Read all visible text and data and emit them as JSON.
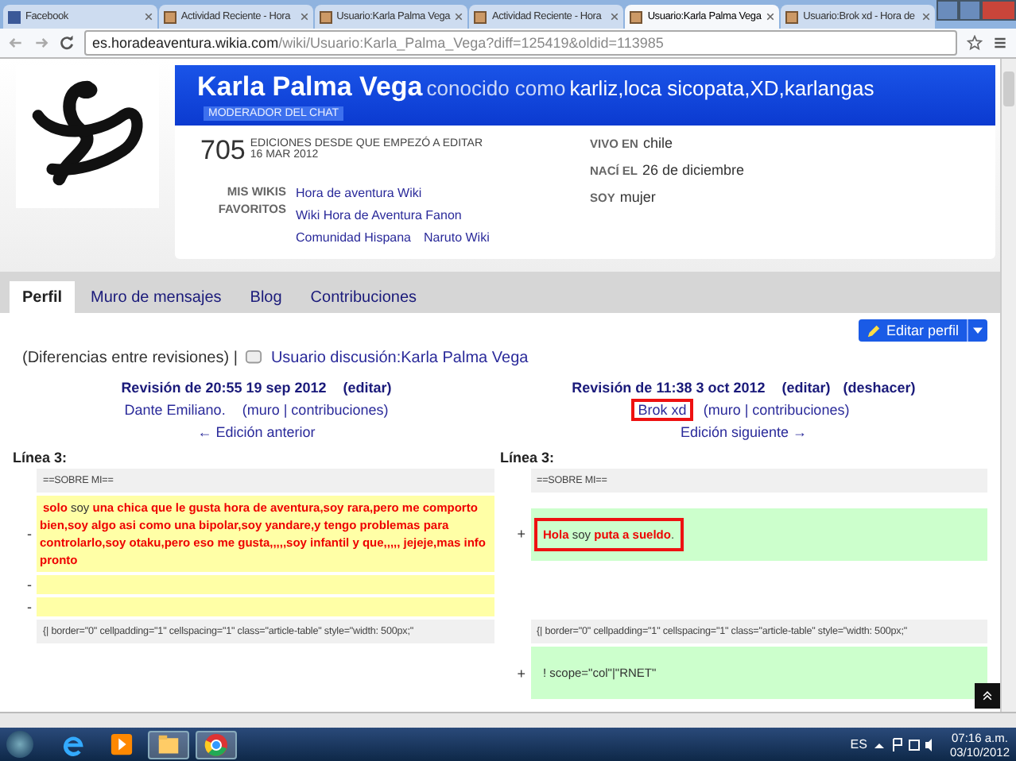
{
  "browser_tabs": [
    {
      "title": "Facebook",
      "kind": "facebook",
      "selected": false
    },
    {
      "title": "Actividad Reciente - Hora",
      "kind": "wiki",
      "selected": false
    },
    {
      "title": "Usuario:Karla Palma Vega",
      "kind": "wiki",
      "selected": false
    },
    {
      "title": "Actividad Reciente - Hora",
      "kind": "wiki",
      "selected": false
    },
    {
      "title": "Usuario:Karla Palma Vega",
      "kind": "wiki",
      "selected": true
    },
    {
      "title": "Usuario:Brok xd - Hora de",
      "kind": "wiki",
      "selected": false
    }
  ],
  "address": {
    "host": "es.horadeaventura.wikia.com",
    "path": "/wiki/Usuario:Karla_Palma_Vega?diff=125419&oldid=113985"
  },
  "profile": {
    "name": "Karla Palma Vega",
    "aka_label": "conocido como",
    "aka": "karliz,loca sicopata,XD,karlangas",
    "badge": "MODERADOR DEL CHAT",
    "edits": "705",
    "edits_label": "EDICIONES DESDE QUE EMPEZÓ A EDITAR",
    "since": "16 MAR 2012",
    "wikis_label": "MIS WIKIS FAVORITOS",
    "wikis": [
      "Hora de aventura Wiki",
      "Wiki Hora de Aventura Fanon",
      "Comunidad Hispana",
      "Naruto Wiki"
    ],
    "facts": [
      {
        "label": "VIVO EN",
        "value": "chile"
      },
      {
        "label": "NACÍ EL",
        "value": "26 de diciembre"
      },
      {
        "label": "SOY",
        "value": "mujer"
      }
    ]
  },
  "page_tabs": [
    {
      "label": "Perfil",
      "selected": true
    },
    {
      "label": "Muro de mensajes",
      "selected": false
    },
    {
      "label": "Blog",
      "selected": false
    },
    {
      "label": "Contribuciones",
      "selected": false
    }
  ],
  "edit_button": "Editar perfil",
  "diff_header": {
    "text": "(Diferencias entre revisiones) |",
    "talk_link": "Usuario discusión:Karla Palma Vega"
  },
  "revisions": [
    {
      "title": "Revisión de 20:55 19 sep 2012",
      "actions": [
        "(editar)"
      ],
      "user": "Dante Emiliano.",
      "user_links": "(muro | contribuciones)",
      "nav": "← Edición anterior",
      "highlighted": false
    },
    {
      "title": "Revisión de 11:38 3 oct 2012",
      "actions": [
        "(editar)",
        "(deshacer)"
      ],
      "user": "Brok xd",
      "user_links": "(muro | contribuciones)",
      "nav": "Edición siguiente →",
      "highlighted": true
    }
  ],
  "line_labels": [
    "Línea 3:",
    "Línea 3:"
  ],
  "diff_rows": [
    {
      "left": {
        "kind": "context",
        "segments": [
          {
            "text": "==SOBRE MI==",
            "changed": false
          }
        ]
      },
      "right": {
        "kind": "context",
        "segments": [
          {
            "text": "==SOBRE MI==",
            "changed": false
          }
        ]
      }
    },
    {
      "left": {
        "kind": "deleted",
        "marker": "-",
        "segments": [
          {
            "text": "solo",
            "changed": true
          },
          {
            "text": " soy ",
            "changed": false
          },
          {
            "text": "una chica que le gusta hora de aventura,soy rara,pero me comporto bien,soy algo asi como una bipolar,soy yandare,y tengo problemas para controlarlo,soy otaku,pero eso me gusta,,,,,soy infantil y que,,,,, jejeje,mas info pronto",
            "changed": true
          }
        ]
      },
      "right": {
        "kind": "added",
        "marker": "+",
        "highlighted": true,
        "segments": [
          {
            "text": "Hola",
            "changed": true
          },
          {
            "text": " soy ",
            "changed": false
          },
          {
            "text": "puta a sueldo",
            "changed": true
          },
          {
            "text": ".",
            "changed": false
          }
        ]
      }
    },
    {
      "left": {
        "kind": "deleted",
        "marker": "-"
      },
      "right": {
        "kind": "empty"
      }
    },
    {
      "left": {
        "kind": "deleted",
        "marker": "-"
      },
      "right": {
        "kind": "empty"
      }
    },
    {
      "left": {
        "kind": "context",
        "segments": [
          {
            "text": "{| border=\"0\" cellpadding=\"1\" cellspacing=\"1\" class=\"article-table\" style=\"width: 500px;\"",
            "changed": false
          }
        ]
      },
      "right": {
        "kind": "context",
        "segments": [
          {
            "text": "{| border=\"0\" cellpadding=\"1\" cellspacing=\"1\" class=\"article-table\" style=\"width: 500px;\"",
            "changed": false
          }
        ]
      }
    },
    {
      "left": {
        "kind": "empty"
      },
      "right": {
        "kind": "added",
        "marker": "+",
        "segments": [
          {
            "text": "! scope=\"col\"|\"RNET\"",
            "changed": false
          }
        ]
      }
    }
  ],
  "taskbar": {
    "language": "ES",
    "time": "07:16 a.m.",
    "date": "03/10/2012",
    "apps": [
      {
        "kind": "ie",
        "selected": false
      },
      {
        "kind": "media",
        "selected": false
      },
      {
        "kind": "explorer",
        "selected": true
      },
      {
        "kind": "chrome",
        "selected": true
      }
    ]
  }
}
